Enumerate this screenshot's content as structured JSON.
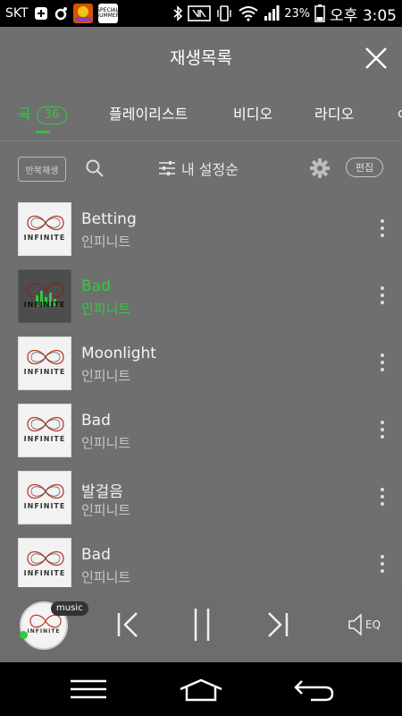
{
  "status_bar": {
    "carrier": "SKT",
    "battery_percent": "23%",
    "time": "오후 3:05",
    "apps": [
      "SPECIAL",
      "SPECIAL SUMMER"
    ]
  },
  "header": {
    "title": "재생목록"
  },
  "tabs": [
    {
      "label": "곡",
      "badge": "36",
      "active": true
    },
    {
      "label": "플레이리스트",
      "active": false
    },
    {
      "label": "비디오",
      "active": false
    },
    {
      "label": "라디오",
      "active": false
    },
    {
      "label": "ㅇ",
      "active": false
    }
  ],
  "toolbar": {
    "repeat_label": "반복재생",
    "sort_label": "내 설정순",
    "edit_label": "편집"
  },
  "songs": [
    {
      "title": "Betting",
      "artist": "인피니트",
      "playing": false
    },
    {
      "title": "Bad",
      "artist": "인피니트",
      "playing": true
    },
    {
      "title": "Moonlight",
      "artist": "인피니트",
      "playing": false
    },
    {
      "title": "Bad",
      "artist": "인피니트",
      "playing": false
    },
    {
      "title": "발걸음",
      "artist": "인피니트",
      "playing": false
    },
    {
      "title": "Bad",
      "artist": "인피니트",
      "playing": false
    }
  ],
  "album_word": "INFINITE",
  "player": {
    "badge": "music",
    "eq_label": "EQ"
  },
  "colors": {
    "accent": "#2ecc40",
    "background": "#6f6f6f",
    "status_bar": "#000000"
  }
}
